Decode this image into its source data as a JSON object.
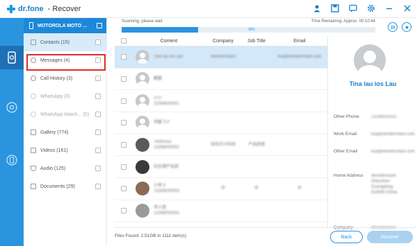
{
  "app": {
    "brand": "dr.fone",
    "title": "- Recover"
  },
  "titlebar_icons": [
    "user-icon",
    "save-icon",
    "feedback-icon",
    "settings-icon",
    "minimize-icon",
    "close-icon"
  ],
  "device": {
    "name": "MOTOROLA MOTO ..."
  },
  "categories": [
    {
      "label": "Contacts (15)",
      "icon": "contacts-icon"
    },
    {
      "label": "Messages (4)",
      "icon": "messages-icon"
    },
    {
      "label": "Call History (3)",
      "icon": "call-history-icon"
    },
    {
      "label": "WhatsApp (0)",
      "icon": "whatsapp-icon"
    },
    {
      "label": "WhatsApp Attach... (0)",
      "icon": "whatsapp-attachment-icon"
    },
    {
      "label": "Gallery (774)",
      "icon": "gallery-icon"
    },
    {
      "label": "Videos (161)",
      "icon": "videos-icon"
    },
    {
      "label": "Audio (125)",
      "icon": "audio-icon"
    },
    {
      "label": "Documents (29)",
      "icon": "documents-icon"
    }
  ],
  "scan": {
    "status": "Scanning, please wait.",
    "time_remaining": "Time Remaining: Approx. 00:10:44",
    "progress_text": "30%",
    "progress": 0.3
  },
  "table": {
    "headers": {
      "content": "Content",
      "company": "Company",
      "job": "Job Title",
      "email": "Email"
    },
    "rows": [
      {
        "name": "Tina lau ios Lau",
        "sub": "",
        "company": "Wondershare",
        "job": "",
        "email": "lisa@wondershare.com"
      },
      {
        "name": "鹏鹏",
        "sub": "",
        "company": "",
        "job": "",
        "email": ""
      },
      {
        "name": "小小",
        "sub": "13268030001",
        "company": "",
        "job": "",
        "email": ""
      },
      {
        "name": "李鹏飞 F",
        "sub": "",
        "company": "",
        "job": "",
        "email": ""
      },
      {
        "name": "Yohfhslos",
        "sub": "13268030002",
        "company": "深圳万兴科技",
        "job": "产品经理",
        "email": ""
      },
      {
        "name": "妇交通产品部",
        "sub": "",
        "company": "",
        "job": "",
        "email": ""
      },
      {
        "name": "小林 3",
        "sub": "13268030003",
        "company": "中",
        "job": "中",
        "email": "中"
      },
      {
        "name": "李小莲",
        "sub": "13268030004",
        "company": "",
        "job": "",
        "email": ""
      }
    ]
  },
  "detail": {
    "name": "Tina lau ios Lau",
    "fields": [
      {
        "label": "Other Phone",
        "value": "13268030001"
      },
      {
        "label": "Work Email",
        "value": "lisa@wondershare.com"
      },
      {
        "label": "Other Email",
        "value": "lisa@wondershare.com"
      },
      {
        "label": "Home Address",
        "value": "Wondershare Shenzhen Guangdong 518000 China"
      },
      {
        "label": "Company",
        "value": "Wondershare"
      }
    ]
  },
  "footer": {
    "files_found": "Files Found: 2.51GB in 1111 item(s)",
    "back_label": "Back",
    "recover_label": "Recover"
  }
}
